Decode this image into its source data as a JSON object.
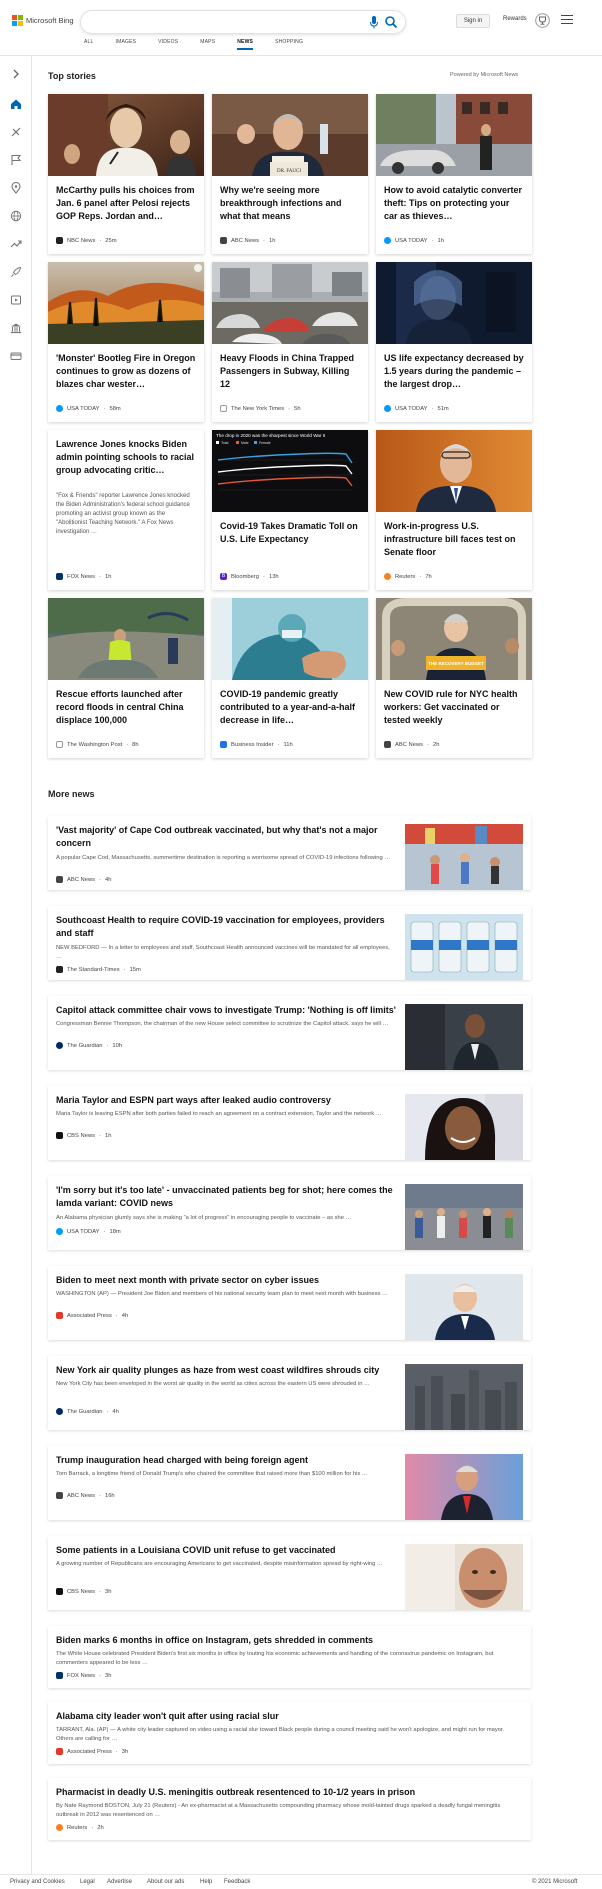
{
  "header": {
    "brand": "Microsoft Bing",
    "search_value": "",
    "signin_label": "Sign in",
    "rewards_label": "Rewards",
    "tabs": [
      "ALL",
      "IMAGES",
      "VIDEOS",
      "MAPS",
      "NEWS",
      "SHOPPING"
    ],
    "active_tab": "NEWS"
  },
  "top_stories": {
    "heading": "Top stories",
    "powered_by": "Powered by Microsoft News",
    "cards": [
      {
        "title": "McCarthy pulls his choices from Jan. 6 panel after Pelosi rejects GOP Reps. Jordan and…",
        "source": "NBC News",
        "time": "25m"
      },
      {
        "title": "Why we're seeing more breakthrough infections and what that means",
        "source": "ABC News",
        "time": "1h"
      },
      {
        "title": "How to avoid catalytic converter theft: Tips on protecting your car as thieves…",
        "source": "USA TODAY",
        "time": "1h"
      },
      {
        "title": "'Monster' Bootleg Fire in Oregon continues to grow as dozens of blazes char wester…",
        "source": "USA TODAY",
        "time": "58m"
      },
      {
        "title": "Heavy Floods in China Trapped Passengers in Subway, Killing 12",
        "source": "The New York Times",
        "time": "5h"
      },
      {
        "title": "US life expectancy decreased by 1.5 years during the pandemic – the largest drop…",
        "source": "USA TODAY",
        "time": "51m"
      },
      {
        "title": "Lawrence Jones knocks Biden admin pointing schools to racial group advocating critic…",
        "snippet": "\"Fox & Friends\" reporter Lawrence Jones knocked the Biden Administration's federal school guidance promoting an activist group known as the \"Abolitionist Teaching Network.\" A Fox News investigation …",
        "source": "FOX News",
        "time": "1h"
      },
      {
        "title": "Covid-19 Takes Dramatic Toll on U.S. Life Expectancy",
        "source": "Bloomberg",
        "time": "13h"
      },
      {
        "title": "Work-in-progress U.S. infrastructure bill faces test on Senate floor",
        "source": "Reuters",
        "time": "7h"
      },
      {
        "title": "Rescue efforts launched after record floods in central China displace 100,000",
        "source": "The Washington Post",
        "time": "8h"
      },
      {
        "title": "COVID-19 pandemic greatly contributed to a year-and-a-half decrease in life…",
        "source": "Business Insider",
        "time": "11h"
      },
      {
        "title": "New COVID rule for NYC health workers: Get vaccinated or tested weekly",
        "source": "ABC News",
        "time": "2h"
      }
    ],
    "chart_caption": "The drop in 2020 was the sharpest since World War II",
    "chart_legend": [
      "Total",
      "Male",
      "Female"
    ],
    "podium_text": "THE RECOVERY BUDGET"
  },
  "more_news": {
    "heading": "More news",
    "items": [
      {
        "title": "'Vast majority' of Cape Cod outbreak vaccinated, but why that's not a major concern",
        "snippet": "A popular Cape Cod, Massachusetts, summertime destination is reporting a worrisome spread of COVID-19 infections following …",
        "source": "ABC News",
        "time": "4h"
      },
      {
        "title": "Southcoast Health to require COVID-19 vaccination for employees, providers and staff",
        "snippet": "NEW BEDFORD — In a letter to employees and staff, Southcoast Health announced vaccines will be mandated for all employees, …",
        "source": "The Standard-Times",
        "time": "15m"
      },
      {
        "title": "Capitol attack committee chair vows to investigate Trump: 'Nothing is off limits'",
        "snippet": "Congressman Bennie Thompson, the chairman of the new House select committee to scrutinize the Capitol attack, says he will …",
        "source": "The Guardian",
        "time": "10h"
      },
      {
        "title": "Maria Taylor and ESPN part ways after leaked audio controversy",
        "snippet": "Maria Taylor is leaving ESPN after both parties failed to reach an agreement on a contract extension, Taylor and the network …",
        "source": "CBS News",
        "time": "1h"
      },
      {
        "title": "'I'm sorry but it's too late' - unvaccinated patients beg for shot; here comes the lamda variant: COVID news",
        "snippet": "An Alabama physician glumly says she is making \"a lot of progress\" in encouraging people to vaccinate – as she …",
        "source": "USA TODAY",
        "time": "18m"
      },
      {
        "title": "Biden to meet next month with private sector on cyber issues",
        "snippet": "WASHINGTON (AP) — President Joe Biden and members of his national security team plan to meet next month with business …",
        "source": "Associated Press",
        "time": "4h"
      },
      {
        "title": "New York air quality plunges as haze from west coast wildfires shrouds city",
        "snippet": "New York City has been enveloped in the worst air quality in the world as cities across the eastern US were shrouded in …",
        "source": "The Guardian",
        "time": "4h"
      },
      {
        "title": "Trump inauguration head charged with being foreign agent",
        "snippet": "Tom Barrack, a longtime friend of Donald Trump's who chaired the committee that raised more than $100 million for his …",
        "source": "ABC News",
        "time": "16h"
      },
      {
        "title": "Some patients in a Louisiana COVID unit refuse to get vaccinated",
        "snippet": "A growing number of Republicans are encouraging Americans to get vaccinated, despite misinformation spread by right-wing …",
        "source": "CBS News",
        "time": "3h"
      },
      {
        "title": "Biden marks 6 months in office on Instagram, gets shredded in comments",
        "snippet": "The White House celebrated President Biden's first six months in office by touting his economic achievements and handling of the coronavirus pandemic on Instagram, but commenters appeared to be less …",
        "source": "FOX News",
        "time": "3h"
      },
      {
        "title": "Alabama city leader won't quit after using racial slur",
        "snippet": "TARRANT, Ala. (AP) — A white city leader captured on video using a racial slur toward Black people during a council meeting said he won't apologize, and might run for mayor. Others are calling for …",
        "source": "Associated Press",
        "time": "3h"
      },
      {
        "title": "Pharmacist in deadly U.S. meningitis outbreak resentenced to 10-1/2 years in prison",
        "snippet": "By Nate Raymond BOSTON, July 21 (Reuters) - An ex-pharmacist at a Massachusetts compounding pharmacy whose mold-tainted drugs sparked a deadly fungal meningitis outbreak in 2012 was resentenced on …",
        "source": "Reuters",
        "time": "2h"
      }
    ]
  },
  "footer": {
    "links": [
      "Privacy and Cookies",
      "Legal",
      "Advertise",
      "About our ads",
      "Help",
      "Feedback"
    ],
    "copyright": "© 2021 Microsoft"
  },
  "colors": {
    "accent": "#0067b8",
    "brand_red": "#f25022",
    "brand_green": "#7fba00",
    "brand_blue": "#00a4ef",
    "brand_yellow": "#ffb900"
  }
}
